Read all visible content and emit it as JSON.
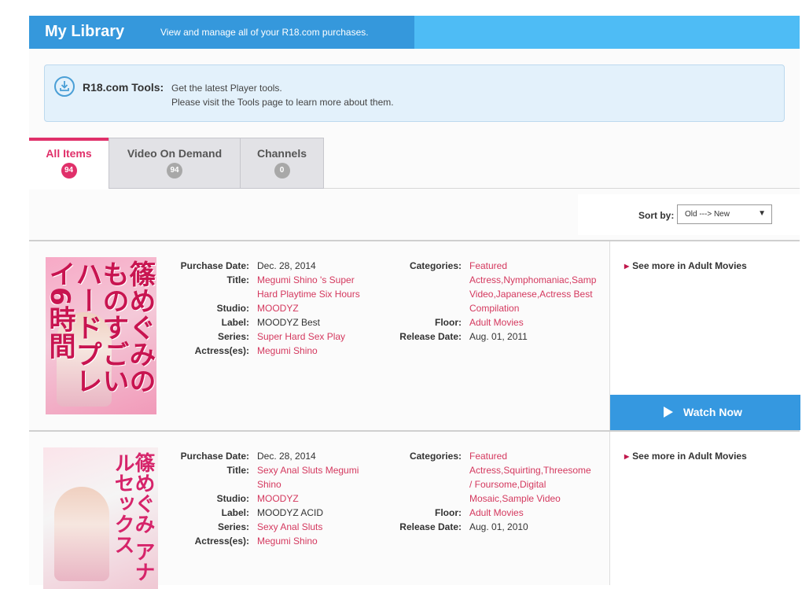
{
  "header": {
    "title": "My Library",
    "subtitle": "View and manage all of your R18.com purchases."
  },
  "tools": {
    "label": "R18.com Tools:",
    "line1": "Get the latest Player tools.",
    "line2": "Please visit the Tools page to learn more about them."
  },
  "tabs": [
    {
      "label": "All Items",
      "count": "94"
    },
    {
      "label": "Video On Demand",
      "count": "94"
    },
    {
      "label": "Channels",
      "count": "0"
    }
  ],
  "sort": {
    "label": "Sort by:",
    "value": "Old ---> New",
    "arrow": "▼"
  },
  "labels": {
    "purchase_date": "Purchase Date:",
    "title": "Title:",
    "studio": "Studio:",
    "label": "Label:",
    "series": "Series:",
    "actress": "Actress(es):",
    "categories": "Categories:",
    "floor": "Floor:",
    "release_date": "Release Date:"
  },
  "items": [
    {
      "cover_text": "篠めぐみのものすごいハードプレイ6時間",
      "purchase_date": "Dec. 28, 2014",
      "title_lines": [
        "Megumi Shino 's Super",
        "Hard Playtime Six Hours"
      ],
      "studio": "MOODYZ",
      "label": "MOODYZ Best",
      "series": "Super Hard Sex Play",
      "actress": "Megumi Shino",
      "categories_lines": [
        "Featured",
        "Actress,Nymphomaniac,Samp",
        "Video,Japanese,Actress Best",
        "Compilation"
      ],
      "floor": "Adult Movies",
      "release_date": "Aug. 01, 2011",
      "see_more": "See more in Adult Movies",
      "watch_now": "Watch Now"
    },
    {
      "cover_text": "篠めぐみ アナルセックス",
      "purchase_date": "Dec. 28, 2014",
      "title_lines": [
        "Sexy Anal Sluts Megumi",
        "Shino"
      ],
      "studio": "MOODYZ",
      "label": "MOODYZ ACID",
      "series": "Sexy Anal Sluts",
      "actress": "Megumi Shino",
      "categories_lines": [
        "Featured",
        "Actress,Squirting,Threesome",
        "/ Foursome,Digital",
        "Mosaic,Sample Video"
      ],
      "floor": "Adult Movies",
      "release_date": "Aug. 01, 2010",
      "see_more": "See more in Adult Movies"
    }
  ],
  "colors": {
    "accent_pink": "#e0306a",
    "link": "#d4385e",
    "header_blue": "#3598dc",
    "header_light_blue": "#4ebcf5",
    "watch_blue": "#3598e0"
  }
}
